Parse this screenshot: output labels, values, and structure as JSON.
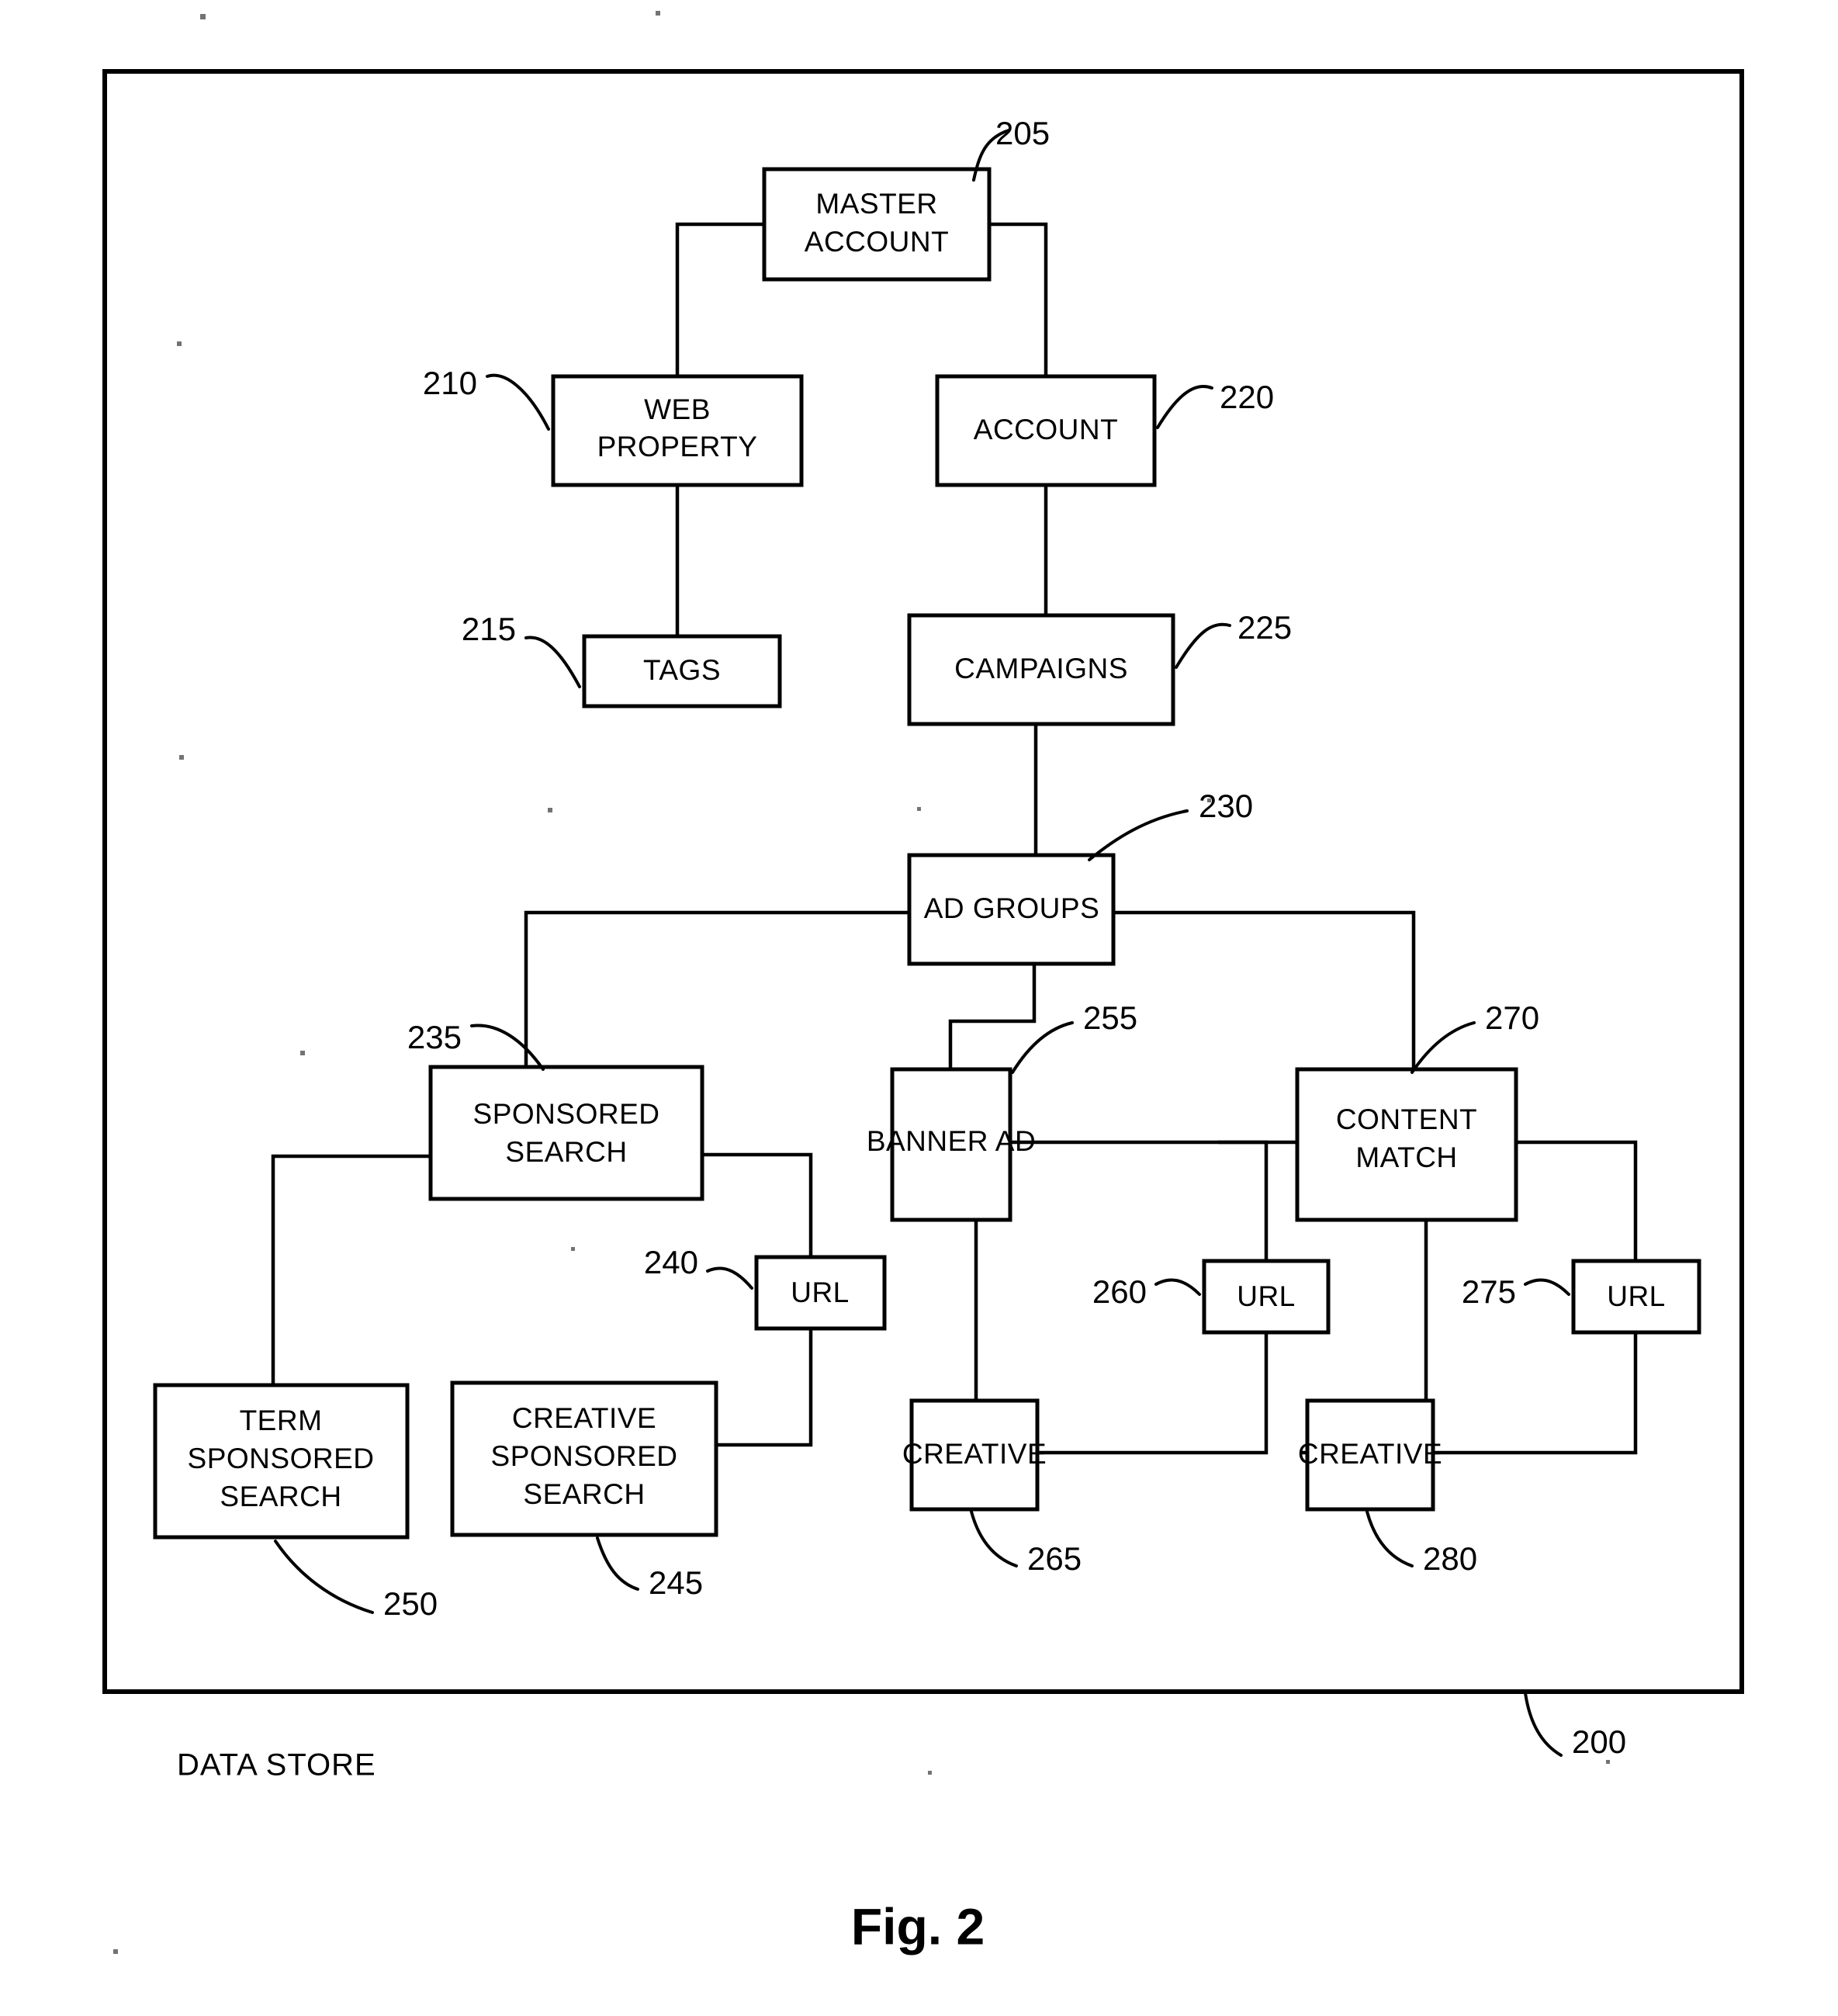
{
  "figure": {
    "caption": "Fig. 2",
    "frame_label": "DATA STORE",
    "frame_ref": "200"
  },
  "nodes": [
    {
      "id": "master_account",
      "label_lines": [
        "MASTER",
        "ACCOUNT"
      ],
      "ref": "205"
    },
    {
      "id": "web_property",
      "label_lines": [
        "WEB",
        "PROPERTY"
      ],
      "ref": "210"
    },
    {
      "id": "tags",
      "label_lines": [
        "TAGS"
      ],
      "ref": "215"
    },
    {
      "id": "account",
      "label_lines": [
        "ACCOUNT"
      ],
      "ref": "220"
    },
    {
      "id": "campaigns",
      "label_lines": [
        "CAMPAIGNS"
      ],
      "ref": "225"
    },
    {
      "id": "ad_groups",
      "label_lines": [
        "AD GROUPS"
      ],
      "ref": "230"
    },
    {
      "id": "sponsored_search",
      "label_lines": [
        "SPONSORED",
        "SEARCH"
      ],
      "ref": "235"
    },
    {
      "id": "url_sponsored_search",
      "label_lines": [
        "URL"
      ],
      "ref": "240"
    },
    {
      "id": "creative_sponsored_search",
      "label_lines": [
        "CREATIVE",
        "SPONSORED",
        "SEARCH"
      ],
      "ref": "245"
    },
    {
      "id": "term_sponsored_search",
      "label_lines": [
        "TERM",
        "SPONSORED",
        "SEARCH"
      ],
      "ref": "250"
    },
    {
      "id": "banner_ad",
      "label_lines": [
        "BANNER AD"
      ],
      "ref": "255"
    },
    {
      "id": "url_banner_ad",
      "label_lines": [
        "URL"
      ],
      "ref": "260"
    },
    {
      "id": "creative_banner_ad",
      "label_lines": [
        "CREATIVE"
      ],
      "ref": "265"
    },
    {
      "id": "content_match",
      "label_lines": [
        "CONTENT",
        "MATCH"
      ],
      "ref": "270"
    },
    {
      "id": "url_content_match",
      "label_lines": [
        "URL"
      ],
      "ref": "275"
    },
    {
      "id": "creative_content_match",
      "label_lines": [
        "CREATIVE"
      ],
      "ref": "280"
    }
  ],
  "colors": {
    "ink": "#000000",
    "paper": "#ffffff"
  }
}
